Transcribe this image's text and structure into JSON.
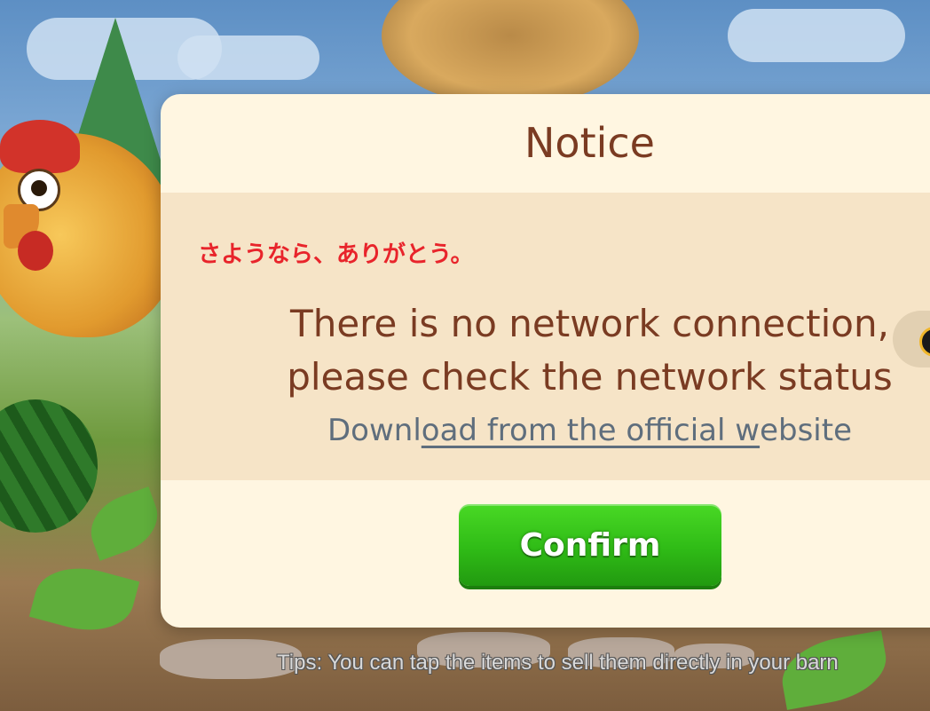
{
  "dialog": {
    "title": "Notice",
    "jp_text": "さようなら、ありがとう。",
    "message_line1": "There is no network connection,",
    "message_line2": "please check the network status",
    "download_prefix": "Downl",
    "download_underlined": "oad from the official w",
    "download_suffix": "ebsite",
    "confirm_label": "Confirm"
  },
  "footer": {
    "tips": "Tips: You can tap the items to sell them directly in your barn"
  },
  "colors": {
    "title": "#7a3b22",
    "jp_text": "#e8242b",
    "confirm_button": "#2fbb16",
    "link": "#5f6e7d"
  }
}
